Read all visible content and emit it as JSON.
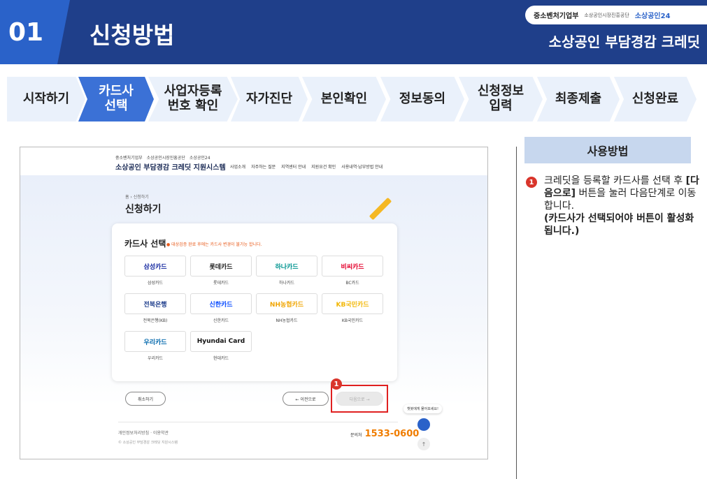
{
  "header": {
    "section_number": "01",
    "title": "신청방법",
    "logos": [
      "중소벤처기업부",
      "소상공인시장진흥공단",
      "소상공인24"
    ],
    "subtitle": "소상공인 부담경감 크레딧"
  },
  "steps": [
    {
      "label": "시작하기",
      "active": false
    },
    {
      "label": "카드사 선택",
      "active": true
    },
    {
      "label": "사업자등록 번호 확인",
      "active": false
    },
    {
      "label": "자가진단",
      "active": false
    },
    {
      "label": "본인확인",
      "active": false
    },
    {
      "label": "정보동의",
      "active": false
    },
    {
      "label": "신청정보 입력",
      "active": false
    },
    {
      "label": "최종제출",
      "active": false
    },
    {
      "label": "신청완료",
      "active": false
    }
  ],
  "screenshot": {
    "small_logos": [
      "중소벤처기업부",
      "소상공인시장진흥공단",
      "소상공인24"
    ],
    "brand": "소상공인 부담경감 크레딧 지원시스템",
    "nav": [
      "사업소개",
      "자주하는 질문",
      "지역센터 안내",
      "지원요건 확인",
      "사용내역·납부방법 안내"
    ],
    "breadcrumb": "홈 › 신청하기",
    "page_title": "신청하기",
    "card_title": "카드사 선택",
    "card_note": "● 대상검증 완료 후에는 카드사 변경이 불가능 합니다.",
    "cards": [
      {
        "logo": "삼성카드",
        "name": "삼성카드",
        "color": "#1428a0"
      },
      {
        "logo": "롯데카드",
        "name": "롯데카드",
        "color": "#222222"
      },
      {
        "logo": "하나카드",
        "name": "하나카드",
        "color": "#009490"
      },
      {
        "logo": "비씨카드",
        "name": "BC카드",
        "color": "#e4002b"
      },
      {
        "logo": "전북은행",
        "name": "전북은행(KB)",
        "color": "#1a3a8a"
      },
      {
        "logo": "신한카드",
        "name": "신한카드",
        "color": "#0046ff"
      },
      {
        "logo": "NH농협카드",
        "name": "NH농협카드",
        "color": "#f0a500"
      },
      {
        "logo": "KB국민카드",
        "name": "KB국민카드",
        "color": "#f2b705"
      },
      {
        "logo": "우리카드",
        "name": "우리카드",
        "color": "#0067ac"
      },
      {
        "logo": "Hyundai Card",
        "name": "현대카드",
        "color": "#111111"
      }
    ],
    "cancel": "취소하기",
    "prev": "← 이전으로",
    "next": "다음으로 →",
    "footer_links": "개인정보처리방침 · 이용약관",
    "copyright": "© 소상공인 부담경감 크레딧 지원시스템",
    "inquiry_label": "문의처",
    "inquiry_number": "1533-0600",
    "chat_bubble": "챗봇에게 물어보세요!",
    "badge_number": "1"
  },
  "instructions": {
    "title": "사용방법",
    "badge": "1",
    "text_before": "크레딧을 등록할 카드사를 선택 후",
    "button_name": "[다음으로]",
    "text_after": "버튼을 눌러 다음단계로 이동합니다.",
    "note": "(카드사가 선택되어야 버튼이 활성화 됩니다.)"
  }
}
